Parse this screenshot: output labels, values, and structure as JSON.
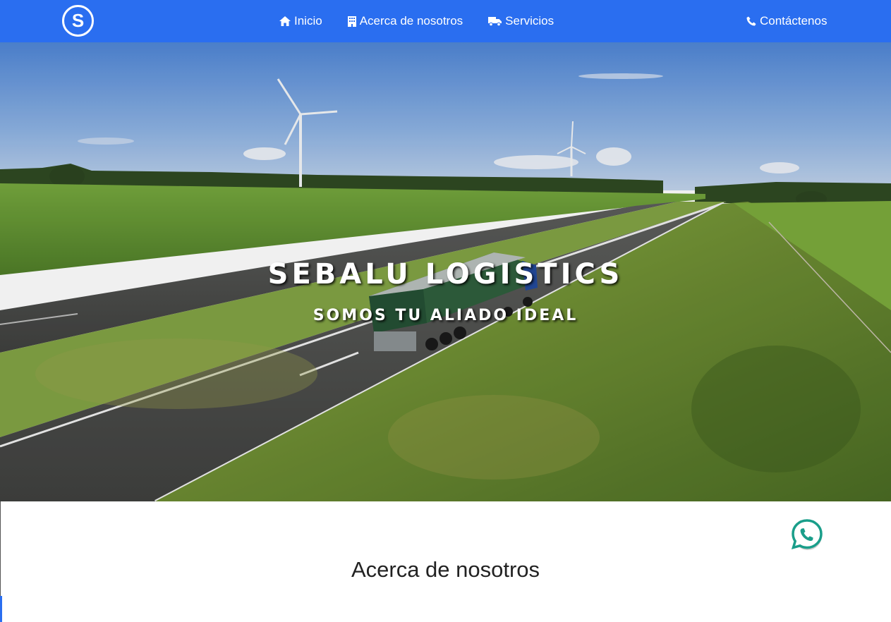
{
  "brand": {
    "logo_letter": "S",
    "color": "#2a6ef0"
  },
  "nav": {
    "items": [
      {
        "label": "Inicio",
        "icon": "home-icon"
      },
      {
        "label": "Acerca de nosotros",
        "icon": "building-icon"
      },
      {
        "label": "Servicios",
        "icon": "truck-icon"
      }
    ],
    "contact": {
      "label": "Contáctenos",
      "icon": "phone-icon"
    }
  },
  "hero": {
    "title": "SEBALU LOGISTICS",
    "subtitle": "SOMOS TU ALIADO IDEAL",
    "background": "highway-truck-wind-turbines-photo"
  },
  "whatsapp": {
    "icon": "whatsapp-icon",
    "color": "#1a9e8a"
  },
  "about": {
    "title": "Acerca de nosotros"
  }
}
